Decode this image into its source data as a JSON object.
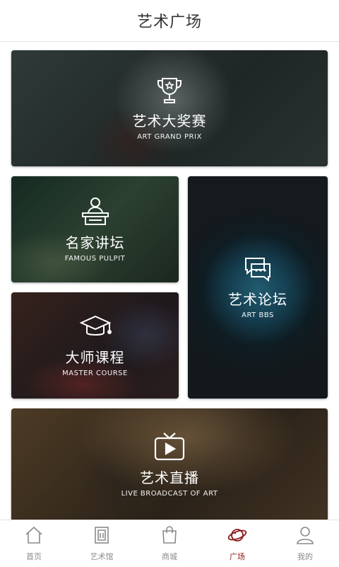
{
  "header": {
    "title": "艺术广场"
  },
  "cards": [
    {
      "title_cn": "艺术大奖赛",
      "title_en": "ART GRAND PRIX",
      "icon": "trophy-icon"
    },
    {
      "title_cn": "名家讲坛",
      "title_en": "FAMOUS  PULPIT",
      "icon": "lectern-icon"
    },
    {
      "title_cn": "大师课程",
      "title_en": "MASTER COURSE",
      "icon": "graduation-cap-icon"
    },
    {
      "title_cn": "艺术论坛",
      "title_en": "ART  BBS",
      "icon": "chat-bubbles-icon"
    },
    {
      "title_cn": "艺术直播",
      "title_en": "LIVE BROADCAST OF ART",
      "icon": "tv-play-icon"
    }
  ],
  "tabbar": {
    "active_index": 3,
    "active_color": "#8b1a1a",
    "items": [
      {
        "label": "首页",
        "icon": "home-icon"
      },
      {
        "label": "艺术馆",
        "icon": "gallery-icon"
      },
      {
        "label": "商城",
        "icon": "shopping-bag-icon"
      },
      {
        "label": "广场",
        "icon": "planet-icon"
      },
      {
        "label": "我的",
        "icon": "user-icon"
      }
    ]
  }
}
